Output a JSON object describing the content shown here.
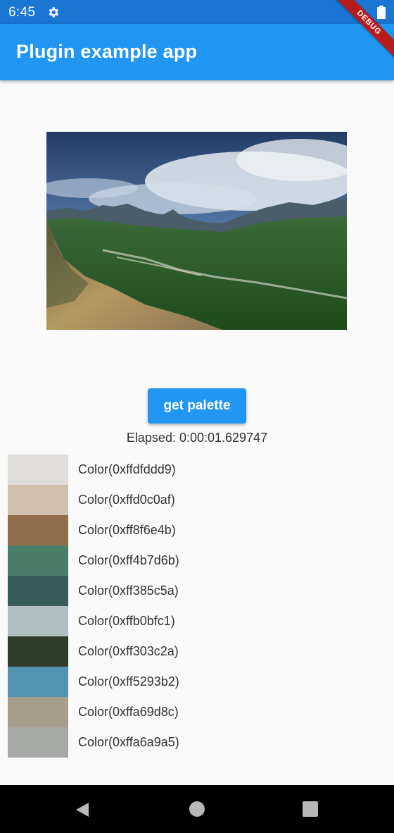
{
  "status_bar": {
    "time": "6:45",
    "icons": [
      "gear-icon",
      "battery-icon"
    ],
    "color": "#1976d2"
  },
  "app_bar": {
    "title": "Plugin example app",
    "color": "#2196f3"
  },
  "debug_banner": {
    "label": "DEBUG",
    "color": "#b71c1c"
  },
  "image": {
    "subject": "mountain-valley-landscape"
  },
  "button": {
    "label": "get palette",
    "color": "#2196f3"
  },
  "elapsed": "Elapsed: 0:00:01.629747",
  "palette": [
    {
      "label": "Color(0xffdfddd9)",
      "hex": "#dfddd9"
    },
    {
      "label": "Color(0xffd0c0af)",
      "hex": "#d0c0af"
    },
    {
      "label": "Color(0xff8f6e4b)",
      "hex": "#8f6e4b"
    },
    {
      "label": "Color(0xff4b7d6b)",
      "hex": "#4b7d6b"
    },
    {
      "label": "Color(0xff385c5a)",
      "hex": "#385c5a"
    },
    {
      "label": "Color(0xffb0bfc1)",
      "hex": "#b0bfc1"
    },
    {
      "label": "Color(0xff303c2a)",
      "hex": "#303c2a"
    },
    {
      "label": "Color(0xff5293b2)",
      "hex": "#5293b2"
    },
    {
      "label": "Color(0xffa69d8c)",
      "hex": "#a69d8c"
    },
    {
      "label": "Color(0xffa6a9a5)",
      "hex": "#a6a9a5"
    }
  ],
  "nav_bar": {
    "icons": [
      "back-icon",
      "home-icon",
      "recents-icon"
    ]
  }
}
